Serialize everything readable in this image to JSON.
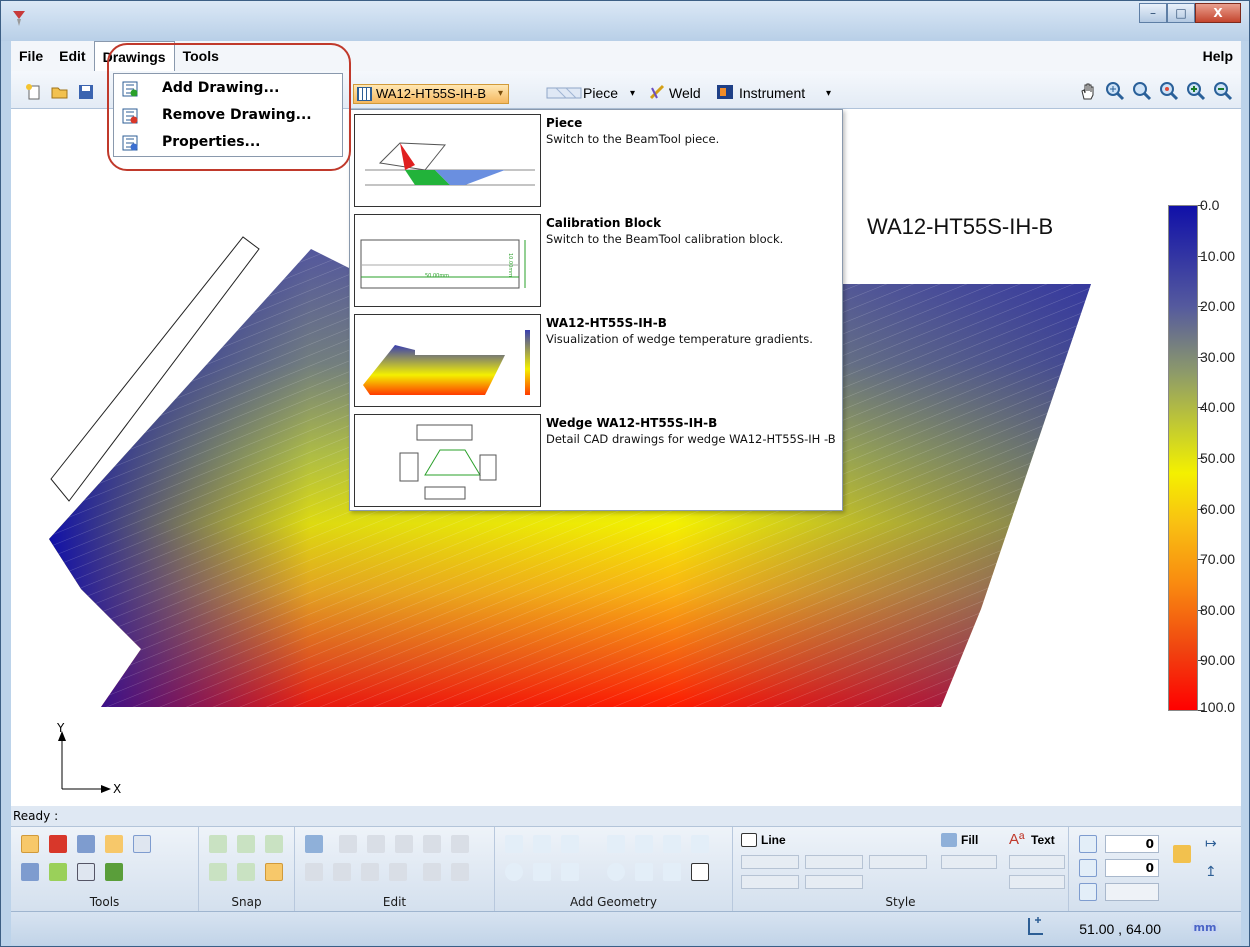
{
  "window": {
    "title": "",
    "controls": {
      "minimize": "–",
      "maximize": "□",
      "close": "X"
    }
  },
  "menubar": {
    "items": [
      "File",
      "Edit",
      "Drawings",
      "Tools"
    ],
    "help": "Help"
  },
  "drawings_menu": {
    "items": [
      {
        "label": "Add Drawing...",
        "icon": "add-drawing-icon"
      },
      {
        "label": "Remove Drawing...",
        "icon": "remove-drawing-icon"
      },
      {
        "label": "Properties...",
        "icon": "properties-icon"
      }
    ]
  },
  "toolbar": {
    "drawing_selector": "WA12-HT55S-IH-B",
    "piece": "Piece",
    "weld": "Weld",
    "instrument": "Instrument"
  },
  "drawing_dropdown": {
    "items": [
      {
        "title": "Piece",
        "description": "Switch to the BeamTool piece."
      },
      {
        "title": "Calibration Block",
        "description": "Switch to the BeamTool calibration block.",
        "thumb_label": "50.00mm",
        "thumb_side": "10.00mm"
      },
      {
        "title": "WA12-HT55S-IH-B",
        "description": "Visualization of wedge temperature gradients."
      },
      {
        "title": "Wedge WA12-HT55S-IH-B",
        "description": "Detail CAD drawings for wedge WA12-HT55S-IH -B"
      }
    ]
  },
  "canvas": {
    "title": "WA12-HT55S-IH-B",
    "axis_x": "X",
    "axis_y": "Y",
    "colorbar_labels": [
      "0.0",
      "10.00",
      "20.00",
      "30.00",
      "40.00",
      "50.00",
      "60.00",
      "70.00",
      "80.00",
      "90.00",
      "100.0"
    ],
    "colors": {
      "low": "#1010a8",
      "mid": "#f4f000",
      "high": "#ff0000"
    }
  },
  "status": {
    "text": "Ready :"
  },
  "ribbon": {
    "groups": [
      "Tools",
      "Snap",
      "Edit",
      "Add Geometry",
      "Style"
    ],
    "line_label": "Line",
    "fill_label": "Fill",
    "text_label": "Text",
    "field1": "0",
    "field2": "0"
  },
  "bottombar": {
    "coords": "51.00 , 64.00",
    "unit": "mm"
  }
}
